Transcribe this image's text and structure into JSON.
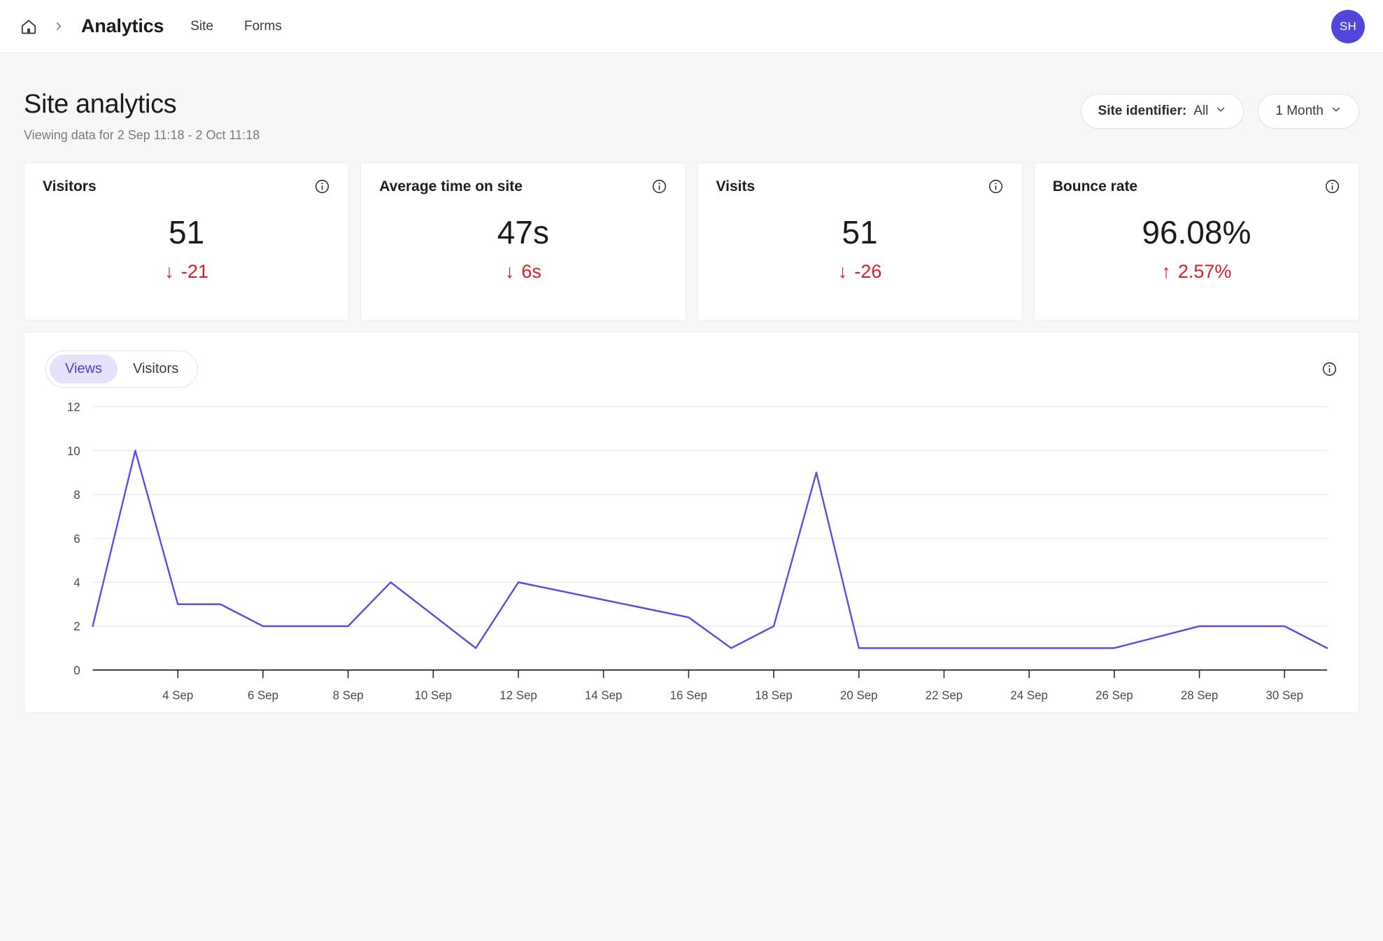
{
  "topbar": {
    "home_icon": "home-icon",
    "separator_icon": "chevron-right-icon",
    "title": "Analytics",
    "tabs": [
      {
        "label": "Site"
      },
      {
        "label": "Forms"
      }
    ],
    "avatar_initials": "SH"
  },
  "page": {
    "title": "Site analytics",
    "subtitle": "Viewing data for 2 Sep 11:18 - 2 Oct 11:18"
  },
  "filters": {
    "site_identifier_label": "Site identifier:",
    "site_identifier_value": "All",
    "period_value": "1 Month",
    "caret_icon": "chevron-down-icon"
  },
  "cards": [
    {
      "title": "Visitors",
      "value": "51",
      "delta": "-21",
      "arrow": "↓",
      "direction": "down",
      "color": "#e01b24",
      "info_icon": "info-icon"
    },
    {
      "title": "Average time on site",
      "value": "47s",
      "delta": "6s",
      "arrow": "↓",
      "direction": "down",
      "color": "#e01b24",
      "info_icon": "info-icon"
    },
    {
      "title": "Visits",
      "value": "51",
      "delta": "-26",
      "arrow": "↓",
      "direction": "down",
      "color": "#e01b24",
      "info_icon": "info-icon"
    },
    {
      "title": "Bounce rate",
      "value": "96.08%",
      "delta": "2.57%",
      "arrow": "↑",
      "direction": "up",
      "color": "#e01b24",
      "info_icon": "info-icon"
    }
  ],
  "chart_panel": {
    "tabs": [
      {
        "label": "Views",
        "active": true
      },
      {
        "label": "Visitors",
        "active": false
      }
    ],
    "info_icon": "info-icon"
  },
  "chart_data": {
    "type": "line",
    "title": "",
    "xlabel": "",
    "ylabel": "",
    "ylim": [
      0,
      12
    ],
    "yticks": [
      0,
      2,
      4,
      6,
      8,
      10,
      12
    ],
    "grid": true,
    "legend": false,
    "line_color": "#5b4ce0",
    "x": [
      "2 Sep",
      "3 Sep",
      "4 Sep",
      "5 Sep",
      "6 Sep",
      "7 Sep",
      "8 Sep",
      "9 Sep",
      "10 Sep",
      "11 Sep",
      "12 Sep",
      "13 Sep",
      "14 Sep",
      "15 Sep",
      "16 Sep",
      "17 Sep",
      "18 Sep",
      "19 Sep",
      "20 Sep",
      "21 Sep",
      "22 Sep",
      "23 Sep",
      "24 Sep",
      "25 Sep",
      "26 Sep",
      "27 Sep",
      "28 Sep",
      "29 Sep",
      "30 Sep",
      "1 Oct"
    ],
    "values": [
      2,
      10,
      3,
      3,
      2,
      2,
      2,
      4,
      2.5,
      1,
      4,
      3.6,
      3.2,
      2.8,
      2.4,
      1,
      2,
      9,
      1,
      1,
      1,
      1,
      1,
      1,
      1,
      1.5,
      2,
      2,
      2,
      1
    ],
    "xticks": [
      "4 Sep",
      "6 Sep",
      "8 Sep",
      "10 Sep",
      "12 Sep",
      "14 Sep",
      "16 Sep",
      "18 Sep",
      "20 Sep",
      "22 Sep",
      "24 Sep",
      "26 Sep",
      "28 Sep",
      "30 Sep"
    ],
    "xtick_indices": [
      2,
      4,
      6,
      8,
      10,
      12,
      14,
      16,
      18,
      20,
      22,
      24,
      26,
      28
    ]
  }
}
